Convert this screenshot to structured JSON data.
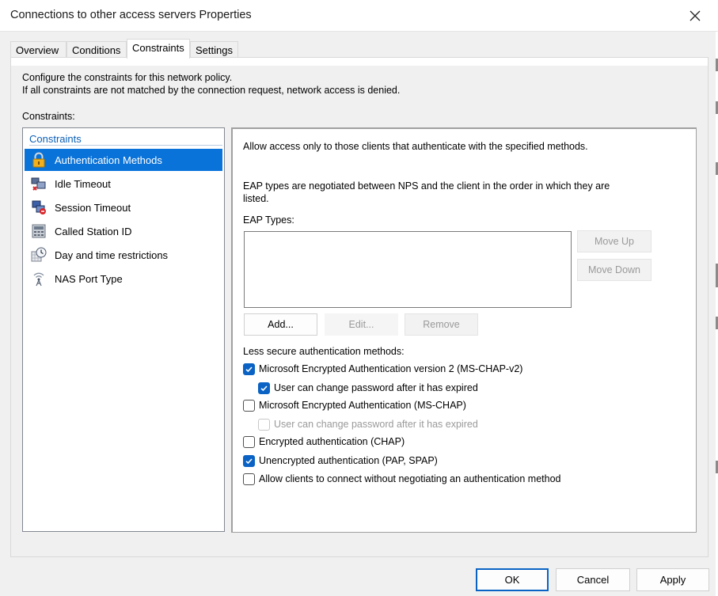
{
  "window": {
    "title": "Connections to other access servers Properties"
  },
  "tabs": [
    {
      "label": "Overview"
    },
    {
      "label": "Conditions"
    },
    {
      "label": "Constraints"
    },
    {
      "label": "Settings"
    }
  ],
  "description": {
    "line1": "Configure the constraints for this network policy.",
    "line2": "If all constraints are not matched by the connection request, network access is denied."
  },
  "constraints_label": "Constraints:",
  "nav": {
    "heading": "Constraints",
    "items": [
      {
        "label": "Authentication Methods",
        "icon": "lock-icon"
      },
      {
        "label": "Idle Timeout",
        "icon": "idle-timeout-icon"
      },
      {
        "label": "Session Timeout",
        "icon": "session-timeout-icon"
      },
      {
        "label": "Called Station ID",
        "icon": "station-id-icon"
      },
      {
        "label": "Day and time restrictions",
        "icon": "clock-icon"
      },
      {
        "label": "NAS Port Type",
        "icon": "antenna-icon"
      }
    ]
  },
  "detail": {
    "intro": "Allow access only to those clients that authenticate with the specified methods.",
    "eap_note_1": "EAP types are negotiated between NPS and the client in the order in which they are",
    "eap_note_2": "listed.",
    "eap_types_label": "EAP Types:",
    "move_up": "Move Up",
    "move_down": "Move Down",
    "add": "Add...",
    "edit": "Edit...",
    "remove": "Remove",
    "less_secure_label": "Less secure authentication methods:",
    "options": [
      {
        "label": "Microsoft Encrypted Authentication version 2 (MS-CHAP-v2)",
        "checked": true
      },
      {
        "label": "User can change password after it has expired",
        "checked": true
      },
      {
        "label": "Microsoft Encrypted Authentication (MS-CHAP)",
        "checked": false
      },
      {
        "label": "User can change password after it has expired",
        "checked": false
      },
      {
        "label": "Encrypted authentication (CHAP)",
        "checked": false
      },
      {
        "label": "Unencrypted authentication (PAP, SPAP)",
        "checked": true
      },
      {
        "label": "Allow clients to connect without negotiating an authentication method",
        "checked": false
      }
    ]
  },
  "footer": {
    "ok": "OK",
    "cancel": "Cancel",
    "apply": "Apply"
  },
  "colors": {
    "accent": "#0a63c4",
    "selection": "#0a73d9",
    "heading": "#0b5fb7"
  }
}
